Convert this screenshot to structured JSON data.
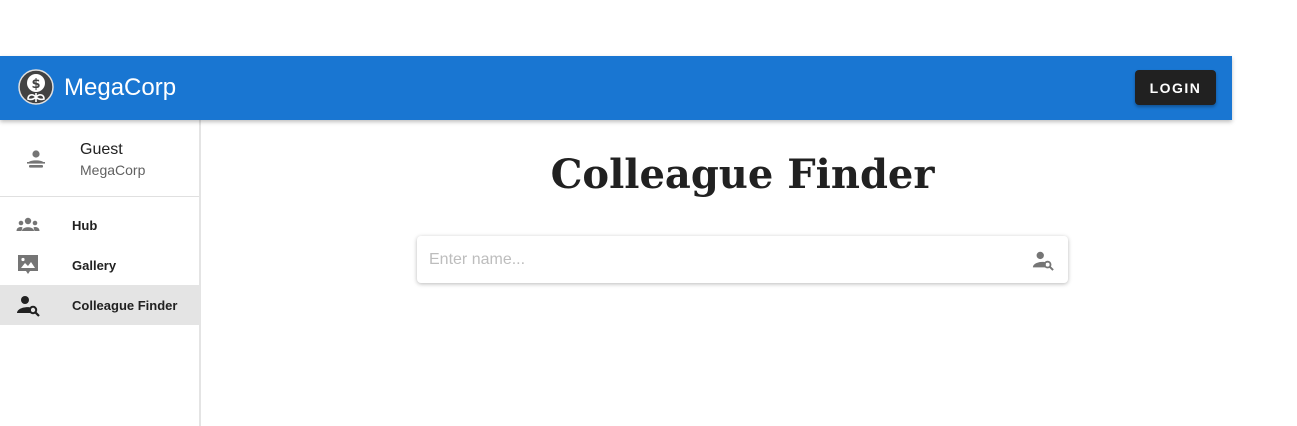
{
  "header": {
    "brand": "MegaCorp",
    "login_label": "LOGIN",
    "logo_icon": "money-plant-icon",
    "bar_color": "#1976d2"
  },
  "sidebar": {
    "user": {
      "name": "Guest",
      "org": "MegaCorp",
      "avatar_icon": "person-icon"
    },
    "items": [
      {
        "label": "Hub",
        "icon": "group-icon",
        "active": false
      },
      {
        "label": "Gallery",
        "icon": "photo-chat-icon",
        "active": false
      },
      {
        "label": "Colleague Finder",
        "icon": "person-search-icon",
        "active": true
      }
    ]
  },
  "main": {
    "title": "Colleague Finder",
    "search": {
      "placeholder": "Enter name...",
      "value": "",
      "icon": "person-search-icon"
    }
  }
}
